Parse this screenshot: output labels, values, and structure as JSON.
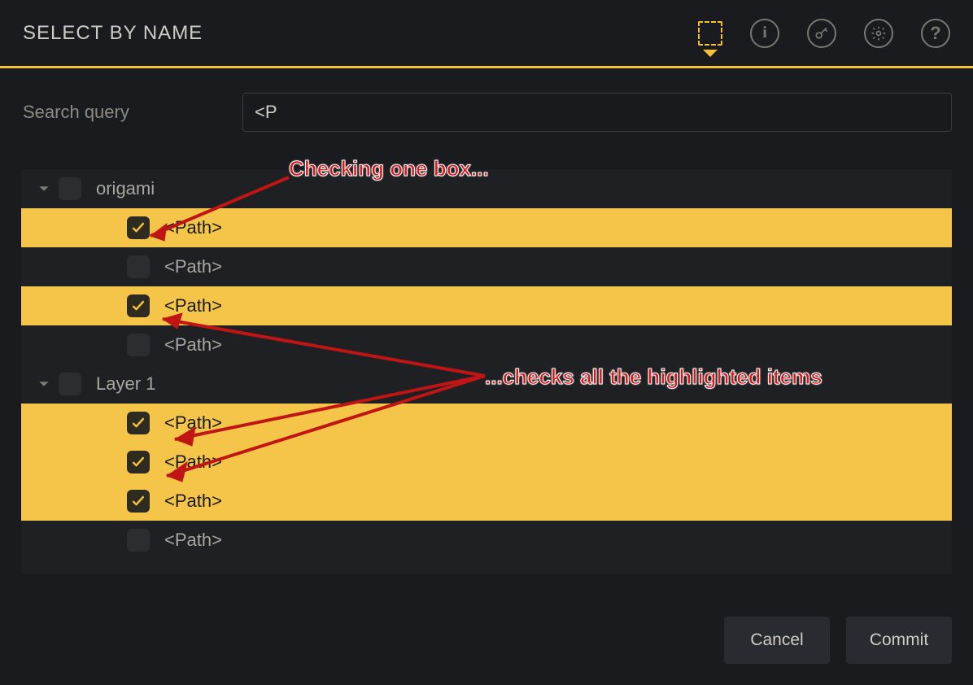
{
  "title": "SELECT BY NAME",
  "search": {
    "label": "Search query",
    "value": "<P"
  },
  "groups": [
    {
      "name": "origami",
      "checked": false,
      "items": [
        {
          "label": "<Path>",
          "checked": true,
          "highlight": true
        },
        {
          "label": "<Path>",
          "checked": false,
          "highlight": false
        },
        {
          "label": "<Path>",
          "checked": true,
          "highlight": true
        },
        {
          "label": "<Path>",
          "checked": false,
          "highlight": false
        }
      ]
    },
    {
      "name": "Layer 1",
      "checked": false,
      "items": [
        {
          "label": "<Path>",
          "checked": true,
          "highlight": true
        },
        {
          "label": "<Path>",
          "checked": true,
          "highlight": true
        },
        {
          "label": "<Path>",
          "checked": true,
          "highlight": true
        },
        {
          "label": "<Path>",
          "checked": false,
          "highlight": false
        }
      ]
    }
  ],
  "buttons": {
    "cancel": "Cancel",
    "commit": "Commit"
  },
  "annotations": {
    "top": "Checking one box...",
    "right": "...checks all the highlighted items"
  }
}
